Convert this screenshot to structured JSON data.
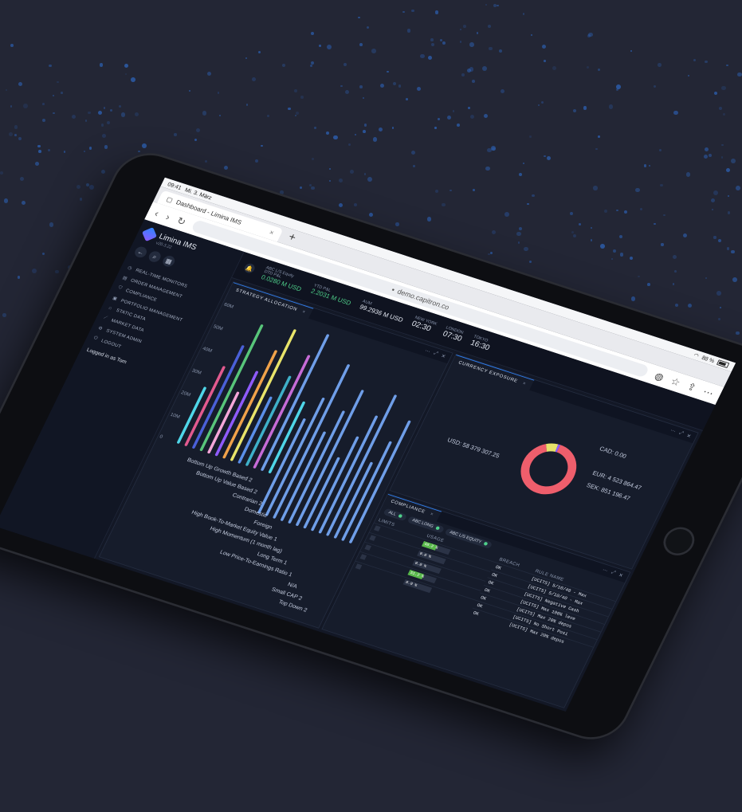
{
  "browser": {
    "status_time": "09:41",
    "status_date": "Mi. 3. März",
    "battery": "88 %",
    "tab_title": "Dashboard - Limina IMS",
    "url": "demo.capitron.co"
  },
  "brand": {
    "name": "Limina IMS",
    "version": "v20.3.22"
  },
  "sidebar": {
    "items": [
      {
        "label": "REAL-TIME MONITORS",
        "icon": "clock-icon"
      },
      {
        "label": "ORDER MANAGEMENT",
        "icon": "orders-icon"
      },
      {
        "label": "COMPLIANCE",
        "icon": "shield-icon"
      },
      {
        "label": "PORTFOLIO MANAGEMENT",
        "icon": "briefcase-icon"
      },
      {
        "label": "STATIC DATA",
        "icon": "home-icon"
      },
      {
        "label": "MARKET DATA",
        "icon": "chart-icon"
      },
      {
        "label": "SYSTEM ADMIN",
        "icon": "gear-icon"
      },
      {
        "label": "LOGOUT",
        "icon": "power-icon"
      }
    ],
    "logged_in": "Logged in as Tom"
  },
  "topbar": {
    "fund": "ABC L/S Equity",
    "dtd_label": "DTD P&L",
    "dtd_value": "0.0280 M USD",
    "ytd_label": "YTD P&L",
    "ytd_value": "2.2031 M USD",
    "aum_label": "AUM",
    "aum_value": "99.2936 M USD",
    "clocks": [
      {
        "city": "NEW YORK",
        "time": "02:30"
      },
      {
        "city": "LONDON",
        "time": "07:30"
      },
      {
        "city": "TOKYO",
        "time": "16:30"
      }
    ]
  },
  "strategy": {
    "title": "STRATEGY ALLOCATION",
    "y_ticks": [
      "0",
      "10M",
      "20M",
      "30M",
      "40M",
      "50M",
      "60M"
    ],
    "categories": [
      "Bottom Up Growth Based 2",
      "Bottom Up Value Based 2",
      "Contrarian 2",
      "Domestic",
      "Foreign",
      "High Book-To-Market Equity Value 1",
      "High Momentum (1 month lag)",
      "Long Term 1",
      "Low Price-To-Earnings Ratio 1",
      "N/A",
      "Small CAP 2",
      "Top Down 2"
    ]
  },
  "chart_data": {
    "type": "bar",
    "categories": [
      "Bottom Up Growth Based 2",
      "Bottom Up Value Based 2",
      "Contrarian 2",
      "Domestic",
      "Foreign",
      "High Book-To-Market Equity Value 1",
      "High Momentum (1 month lag)",
      "Long Term 1",
      "Low Price-To-Earnings Ratio 1",
      "N/A",
      "Small CAP 2",
      "Top Down 2"
    ],
    "ylim": [
      0,
      60000000
    ],
    "colors": [
      "#4fd6e8",
      "#e25a8f",
      "#4a60d8",
      "#58c57a",
      "#f4a6d8",
      "#8f5bff",
      "#f0a24a",
      "#e8e46a",
      "#5b8fe8",
      "#3fb0c9",
      "#c66bd6",
      "#6f9ee8"
    ]
  },
  "currency": {
    "title": "CURRENCY EXPOSURE",
    "slices": [
      {
        "label": "USD: 58 379 307.25",
        "value": 58379307.25,
        "color": "#ee5e6c"
      },
      {
        "label": "CAD: 0.00",
        "value": 0.0,
        "color": "#e6e26b"
      },
      {
        "label": "EUR: 4 523 864.47",
        "value": 4523864.47,
        "color": "#e6e26b"
      },
      {
        "label": "SEK: 851 196.47",
        "value": 851196.47,
        "color": "#8f5bff"
      }
    ]
  },
  "compliance": {
    "title": "COMPLIANCE",
    "tabs": [
      "ALL",
      "ABC LONG",
      "ABC L/S EQUITY"
    ],
    "limits_label": "LIMITS",
    "usage_header": "USAGE",
    "usage": [
      {
        "text": "48.2 %",
        "value": 48.2
      },
      {
        "text": "0.0 %",
        "value": 0.0
      },
      {
        "text": "0.0 %",
        "value": 0.0
      },
      {
        "text": "51.2 %",
        "value": 51.2
      },
      {
        "text": "0.0 %",
        "value": 0.0
      }
    ],
    "columns": [
      "BREACH",
      "RULE NAME"
    ],
    "rows": [
      {
        "breach": "OK",
        "rule": "[UCITS] 5/10/40 - Max"
      },
      {
        "breach": "OK",
        "rule": "[UCITS] 5/10/40 - Max"
      },
      {
        "breach": "OK",
        "rule": "[UCITS] Negative Cash"
      },
      {
        "breach": "OK",
        "rule": "[UCITS] Max 100% leve"
      },
      {
        "breach": "OK",
        "rule": "[UCITS] Max 20% depos"
      },
      {
        "breach": "OK",
        "rule": "[UCITS] No Short Posi"
      },
      {
        "breach": "OK",
        "rule": "[UCITS] Max 20% depos"
      }
    ]
  }
}
